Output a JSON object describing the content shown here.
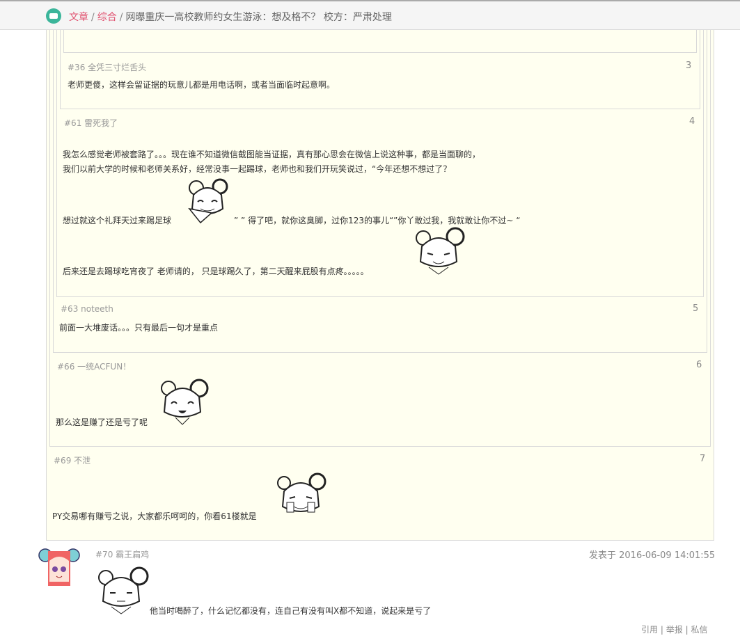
{
  "breadcrumb": {
    "category1": "文章",
    "category2": "综合",
    "separator": "/",
    "title": "网曝重庆一高校教师约女生游泳：想及格不？ 校方：严肃处理"
  },
  "comments": [
    {
      "meta": "#36 全凭三寸烂舌头",
      "num": "3",
      "text": "老师更傻，这样会留证据的玩意儿都是用电话啊，或者当面临时起意啊。"
    },
    {
      "meta": "#61 雷死我了",
      "num": "4",
      "line1": "我怎么感觉老师被套路了。。。现在谁不知道微信截图能当证据，真有那心思会在微信上说这种事，都是当面聊的，",
      "line2": "我们以前大学的时候和老师关系好，经常没事一起踢球，老师也和我们开玩笑说过，“今年还想不想过了？",
      "line3a": "想过就这个礼拜天过来踢足球",
      "line3b": "” ” 得了吧，就你这臭脚，过你123的事儿“”你丫敢过我，我就敢让你不过~ “",
      "line4": "后来还是去踢球吃宵夜了 老师请的， 只是球踢久了，第二天醒来屁股有点疼。。。。。"
    },
    {
      "meta": "#63 noteeth",
      "num": "5",
      "text": "前面一大堆废话。。。只有最后一句才是重点"
    },
    {
      "meta": "#66 一统ACFUN！",
      "num": "6",
      "text": "那么这是赚了还是亏了呢"
    },
    {
      "meta": "#69 不泄",
      "num": "7",
      "text": "PY交易哪有赚亏之说，大家都乐呵呵的，你看61楼就是"
    }
  ],
  "main_post": {
    "meta": "#70 霸王扁鸡",
    "date": "发表于 2016-06-09 14:01:55",
    "text": "他当时喝醉了，什么记忆都没有，连自己有没有叫X都不知道，说起来是亏了"
  },
  "actions": {
    "quote": "引用",
    "report": "举报",
    "message": "私信",
    "sep": "|"
  },
  "colors": {
    "link": "#e0506e",
    "quote_bg": "#fffff0",
    "logo": "#3bb59a"
  }
}
